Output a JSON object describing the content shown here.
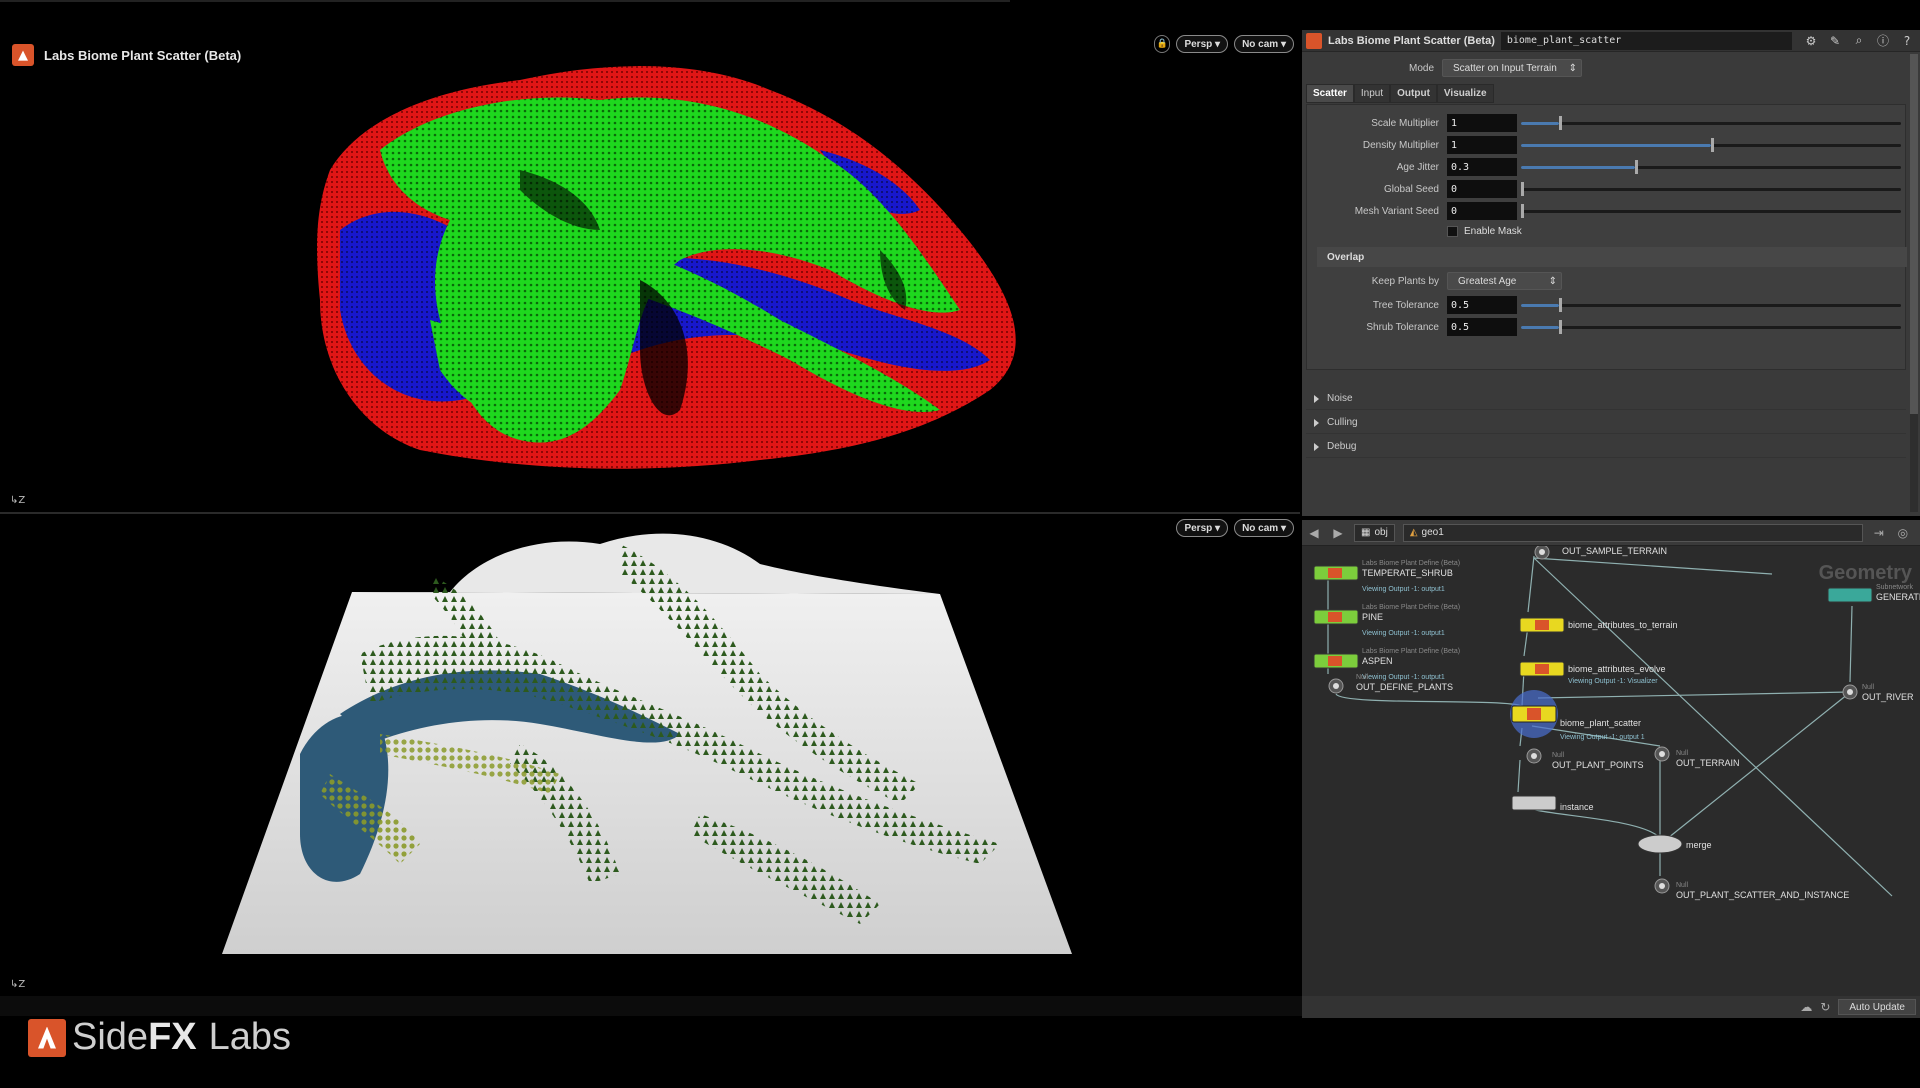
{
  "viewport_top": {
    "title": "Labs Biome Plant Scatter (Beta)",
    "camera_mode": "Persp",
    "camera": "No cam",
    "axis_label": "Z"
  },
  "viewport_bottom": {
    "camera_mode": "Persp",
    "camera": "No cam",
    "axis_label": "Z"
  },
  "parameters": {
    "node_type": "Labs Biome Plant Scatter (Beta)",
    "node_name": "biome_plant_scatter",
    "mode_label": "Mode",
    "mode_value": "Scatter on Input Terrain",
    "tabs": [
      {
        "label": "Scatter",
        "active": true
      },
      {
        "label": "Input",
        "active": false
      },
      {
        "label": "Output",
        "active": false
      },
      {
        "label": "Visualize",
        "active": false
      }
    ],
    "fields": [
      {
        "label": "Scale Multiplier",
        "value": "1",
        "level": 0.1
      },
      {
        "label": "Density Multiplier",
        "value": "1",
        "level": 0.5
      },
      {
        "label": "Age Jitter",
        "value": "0.3",
        "level": 0.3
      },
      {
        "label": "Global Seed",
        "value": "0",
        "level": 0.0
      },
      {
        "label": "Mesh Variant Seed",
        "value": "0",
        "level": 0.0
      }
    ],
    "enable_mask_label": "Enable Mask",
    "enable_mask_checked": false,
    "overlap_header": "Overlap",
    "keep_plants_label": "Keep Plants by",
    "keep_plants_value": "Greatest Age",
    "overlap_fields": [
      {
        "label": "Tree Tolerance",
        "value": "0.5",
        "level": 0.1
      },
      {
        "label": "Shrub Tolerance",
        "value": "0.5",
        "level": 0.1
      }
    ],
    "collapsed_sections": [
      "Noise",
      "Culling",
      "Debug"
    ]
  },
  "network": {
    "path_root": "obj",
    "path_node": "geo1",
    "context_title": "Geometry",
    "nodes": [
      {
        "name": "OUT_SAMPLE_TERRAIN",
        "sub": "",
        "flag": ""
      },
      {
        "name": "TEMPERATE_SHRUB",
        "sub": "Labs Biome Plant Define (Beta)",
        "flag": "Viewing Output -1: output1"
      },
      {
        "name": "PINE",
        "sub": "Labs Biome Plant Define (Beta)",
        "flag": "Viewing Output -1: output1"
      },
      {
        "name": "ASPEN",
        "sub": "Labs Biome Plant Define (Beta)",
        "flag": "Viewing Output -1: output1"
      },
      {
        "name": "OUT_DEFINE_PLANTS",
        "sub": "Null",
        "flag": ""
      },
      {
        "name": "biome_attributes_to_terrain",
        "sub": "",
        "flag": ""
      },
      {
        "name": "biome_attributes_evolve",
        "sub": "",
        "flag": "Viewing Output -1: Visualizer"
      },
      {
        "name": "GENERATE",
        "sub": "Subnetwork",
        "flag": ""
      },
      {
        "name": "OUT_RIVER",
        "sub": "Null",
        "flag": ""
      },
      {
        "name": "biome_plant_scatter",
        "sub": "",
        "flag": "Viewing Output -1: output 1"
      },
      {
        "name": "OUT_PLANT_POINTS",
        "sub": "Null",
        "flag": ""
      },
      {
        "name": "OUT_TERRAIN",
        "sub": "Null",
        "flag": ""
      },
      {
        "name": "instance",
        "sub": "",
        "flag": ""
      },
      {
        "name": "merge",
        "sub": "",
        "flag": ""
      },
      {
        "name": "OUT_PLANT_SCATTER_AND_INSTANCE",
        "sub": "Null",
        "flag": ""
      }
    ]
  },
  "status": {
    "update_mode": "Auto Update"
  },
  "brand": {
    "side": "Side",
    "fx": "FX",
    "labs": "Labs"
  },
  "colors": {
    "accent": "#d9542a",
    "scatter_green": "#22e022",
    "scatter_red": "#e01818",
    "scatter_blue": "#1a1ad0",
    "node_yellow": "#e8d820",
    "node_green": "#7ccd3c",
    "node_teal": "#3aa89a"
  }
}
